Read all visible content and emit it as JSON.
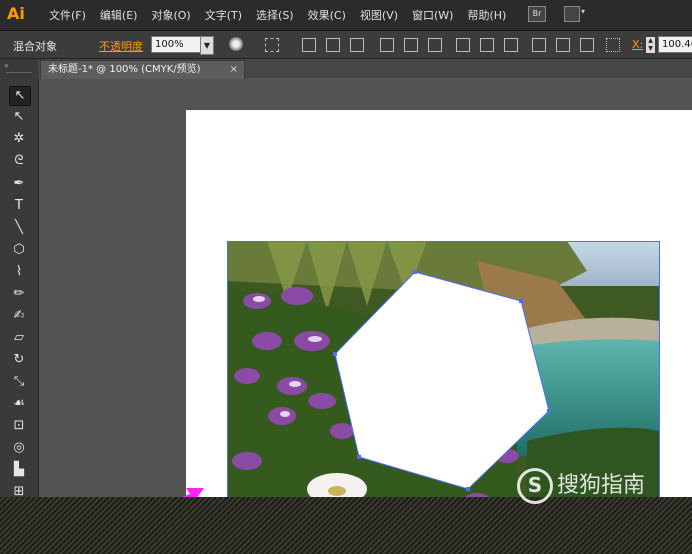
{
  "app": {
    "logo": "Ai"
  },
  "menu": [
    "文件(F)",
    "编辑(E)",
    "对象(O)",
    "文字(T)",
    "选择(S)",
    "效果(C)",
    "视图(V)",
    "窗口(W)",
    "帮助(H)"
  ],
  "menubar_icons": {
    "bridge": "Br",
    "arrange": "workspace-arrange-icon"
  },
  "control_bar": {
    "object_type": "混合对象",
    "opacity_label": "不透明度",
    "opacity_value": "100%",
    "x_label": "X:",
    "x_value": "100.4("
  },
  "document_tab": {
    "title": "未标题-1* @ 100% (CMYK/预览)",
    "close": "×"
  },
  "tools": [
    {
      "name": "selection-tool",
      "glyph": "↖"
    },
    {
      "name": "direct-selection-tool",
      "glyph": "↖"
    },
    {
      "name": "magic-wand-tool",
      "glyph": "✲"
    },
    {
      "name": "lasso-tool",
      "glyph": "ᘓ"
    },
    {
      "name": "pen-tool",
      "glyph": "✒"
    },
    {
      "name": "type-tool",
      "glyph": "T"
    },
    {
      "name": "line-tool",
      "glyph": "╲"
    },
    {
      "name": "ellipse-tool",
      "glyph": "⬡"
    },
    {
      "name": "paintbrush-tool",
      "glyph": "⌇"
    },
    {
      "name": "pencil-tool",
      "glyph": "✏"
    },
    {
      "name": "blob-brush-tool",
      "glyph": "✍"
    },
    {
      "name": "eraser-tool",
      "glyph": "▱"
    },
    {
      "name": "rotate-tool",
      "glyph": "↻"
    },
    {
      "name": "scale-tool",
      "glyph": "⤡"
    },
    {
      "name": "warp-tool",
      "glyph": "☙"
    },
    {
      "name": "free-transform-tool",
      "glyph": "⊡"
    },
    {
      "name": "shape-builder-tool",
      "glyph": "◎"
    },
    {
      "name": "graph-tool",
      "glyph": "▙"
    },
    {
      "name": "symbol-sprayer-tool",
      "glyph": "⊞"
    }
  ],
  "watermark": {
    "s": "S",
    "text": "搜狗指南"
  },
  "colors": {
    "accent_orange": "#ff9a00",
    "selection_blue": "#4a6cff",
    "arrow_magenta": "#ff22ff"
  }
}
